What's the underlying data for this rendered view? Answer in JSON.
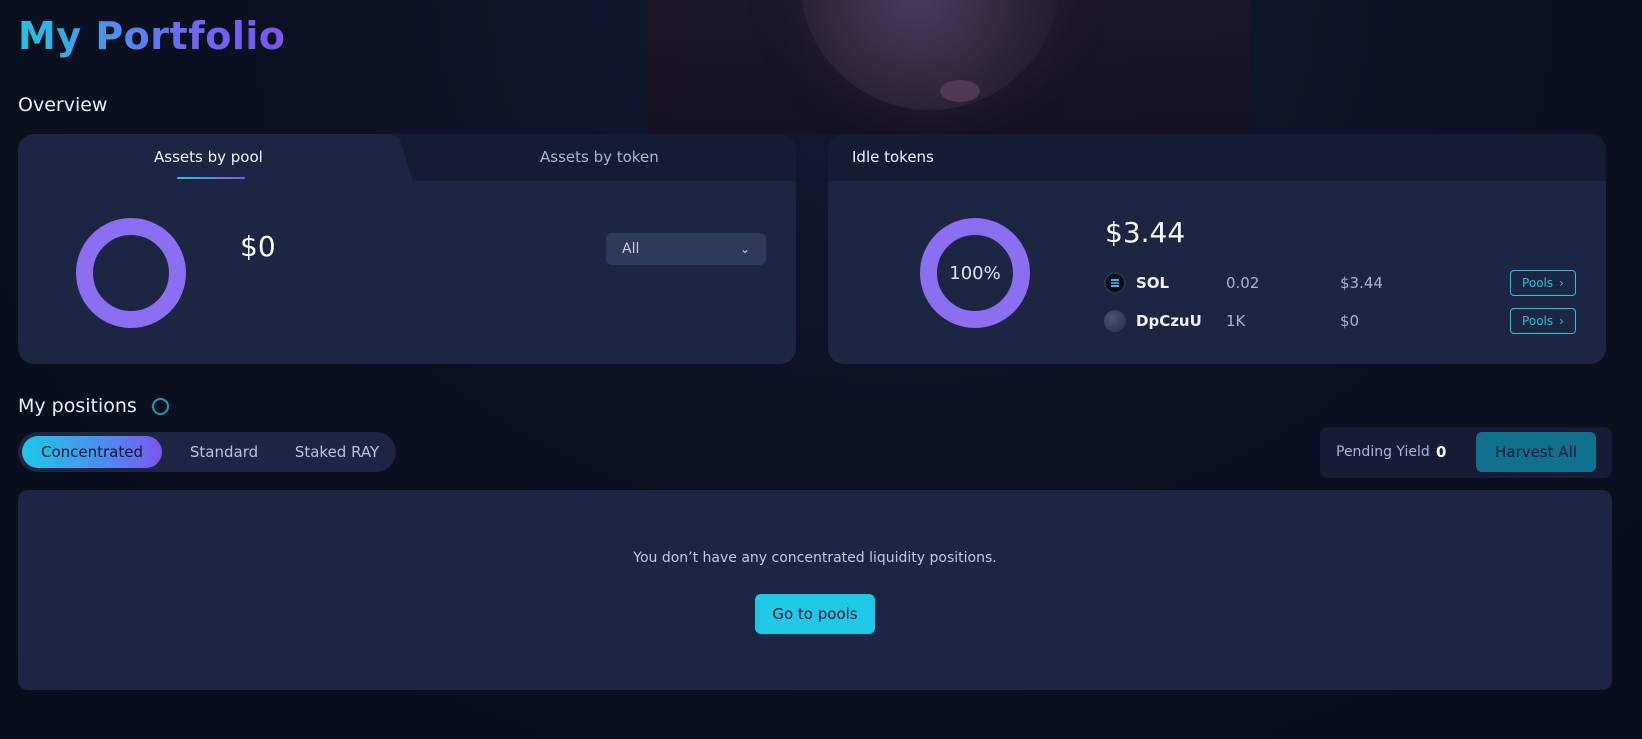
{
  "page": {
    "title": "My Portfolio"
  },
  "overview": {
    "title": "Overview",
    "assets_card": {
      "tabs": [
        {
          "label": "Assets by pool",
          "active": true
        },
        {
          "label": "Assets by token",
          "active": false
        }
      ],
      "value": "$0",
      "filter": {
        "selected": "All"
      }
    },
    "idle_card": {
      "title": "Idle tokens",
      "donut_label": "100%",
      "total": "$3.44",
      "tokens": [
        {
          "symbol": "SOL",
          "amount": "0.02",
          "usd": "$3.44",
          "button": "Pools"
        },
        {
          "symbol": "DpCzuU",
          "amount": "1K",
          "usd": "$0",
          "button": "Pools"
        }
      ]
    }
  },
  "positions": {
    "title": "My positions",
    "tabs": [
      {
        "label": "Concentrated",
        "active": true
      },
      {
        "label": "Standard",
        "active": false
      },
      {
        "label": "Staked RAY",
        "active": false
      }
    ],
    "pending_yield_label": "Pending Yield",
    "pending_yield_value": "0",
    "harvest_label": "Harvest All",
    "empty_message": "You don’t have any concentrated liquidity positions.",
    "goto_pools_label": "Go to pools"
  },
  "colors": {
    "accent_cyan": "#1ec8e6",
    "accent_purple": "#7d55f0",
    "donut": "#8b6ff0",
    "card_bg": "#1c2541"
  }
}
